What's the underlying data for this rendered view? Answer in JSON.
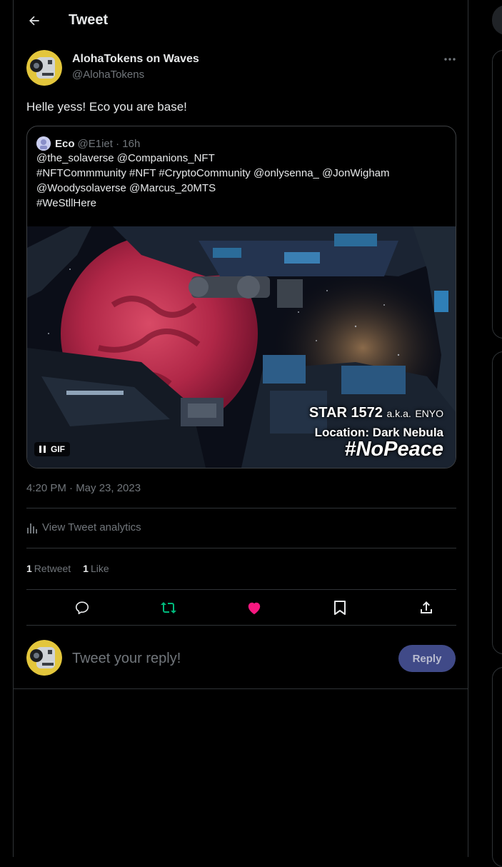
{
  "header": {
    "title": "Tweet"
  },
  "author": {
    "display_name": "AlohaTokens on Waves",
    "handle": "@AlohaTokens"
  },
  "tweet": {
    "text": "Helle yess! Eco you are base!"
  },
  "quoted_tweet": {
    "name": "Eco",
    "handle_time": "@E1iet · 16h",
    "lines": [
      "@the_solaverse @Companions_NFT",
      "#NFTCommmunity #NFT #CryptoCommunity @onlysenna_ @JonWigham",
      "@Woodysolaverse @Marcus_20MTS",
      "#WeStllHere"
    ],
    "media": {
      "gif_label": "GIF",
      "overlay_star": "STAR 1572",
      "overlay_aka": "a.k.a.",
      "overlay_name": "ENYO",
      "overlay_location": "Location: Dark Nebula",
      "overlay_hashtag": "#NoPeace"
    }
  },
  "timestamp": "4:20 PM · May 23, 2023",
  "analytics_label": "View Tweet analytics",
  "stats": {
    "retweet_count": "1",
    "retweet_label": "Retweet",
    "like_count": "1",
    "like_label": "Like"
  },
  "reply": {
    "placeholder": "Tweet your reply!",
    "button_label": "Reply"
  },
  "colors": {
    "background": "#000000",
    "text": "#e7e9ea",
    "muted": "#71767b",
    "retweet_green": "#00ba7c",
    "like_pink": "#f91880",
    "reply_button": "#404a88"
  },
  "icons": {
    "back": "arrow-left-icon",
    "more": "more-horizontal-icon",
    "reply": "reply-icon",
    "retweet": "retweet-icon",
    "like": "heart-icon",
    "bookmark": "bookmark-icon",
    "share": "share-icon",
    "analytics": "bar-chart-icon",
    "pause": "pause-icon"
  }
}
